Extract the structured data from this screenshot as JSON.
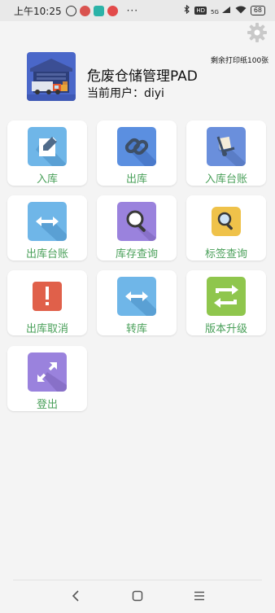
{
  "status_bar": {
    "time": "上午10:25",
    "more": "···",
    "network": "5G",
    "battery": "68"
  },
  "header": {
    "paper_remaining": "剩余打印纸100张",
    "title": "危废仓储管理PAD",
    "current_user_label": "当前用户：diyi"
  },
  "menu": [
    {
      "label": "入库",
      "icon": "edit-icon",
      "color": "#6fb6e8"
    },
    {
      "label": "出库",
      "icon": "link-icon",
      "color": "#5b8fe0"
    },
    {
      "label": "入库台账",
      "icon": "hand-truck-icon",
      "color": "#6a8fdc"
    },
    {
      "label": "出库台账",
      "icon": "double-arrow-icon",
      "color": "#6fb6e8"
    },
    {
      "label": "库存查询",
      "icon": "magnifier-icon",
      "color": "#9a82dd"
    },
    {
      "label": "标签查询",
      "icon": "magnifier-icon",
      "color": "#efc24a"
    },
    {
      "label": "出库取消",
      "icon": "exclamation-icon",
      "color": "#e0604a"
    },
    {
      "label": "转库",
      "icon": "double-arrow-icon",
      "color": "#6fb6e8"
    },
    {
      "label": "版本升级",
      "icon": "swap-arrows-icon",
      "color": "#8fc64d"
    },
    {
      "label": "登出",
      "icon": "expand-arrows-icon",
      "color": "#9a82dd"
    }
  ],
  "colors": {
    "label_green": "#4aa05a",
    "background": "#f4f4f4"
  }
}
